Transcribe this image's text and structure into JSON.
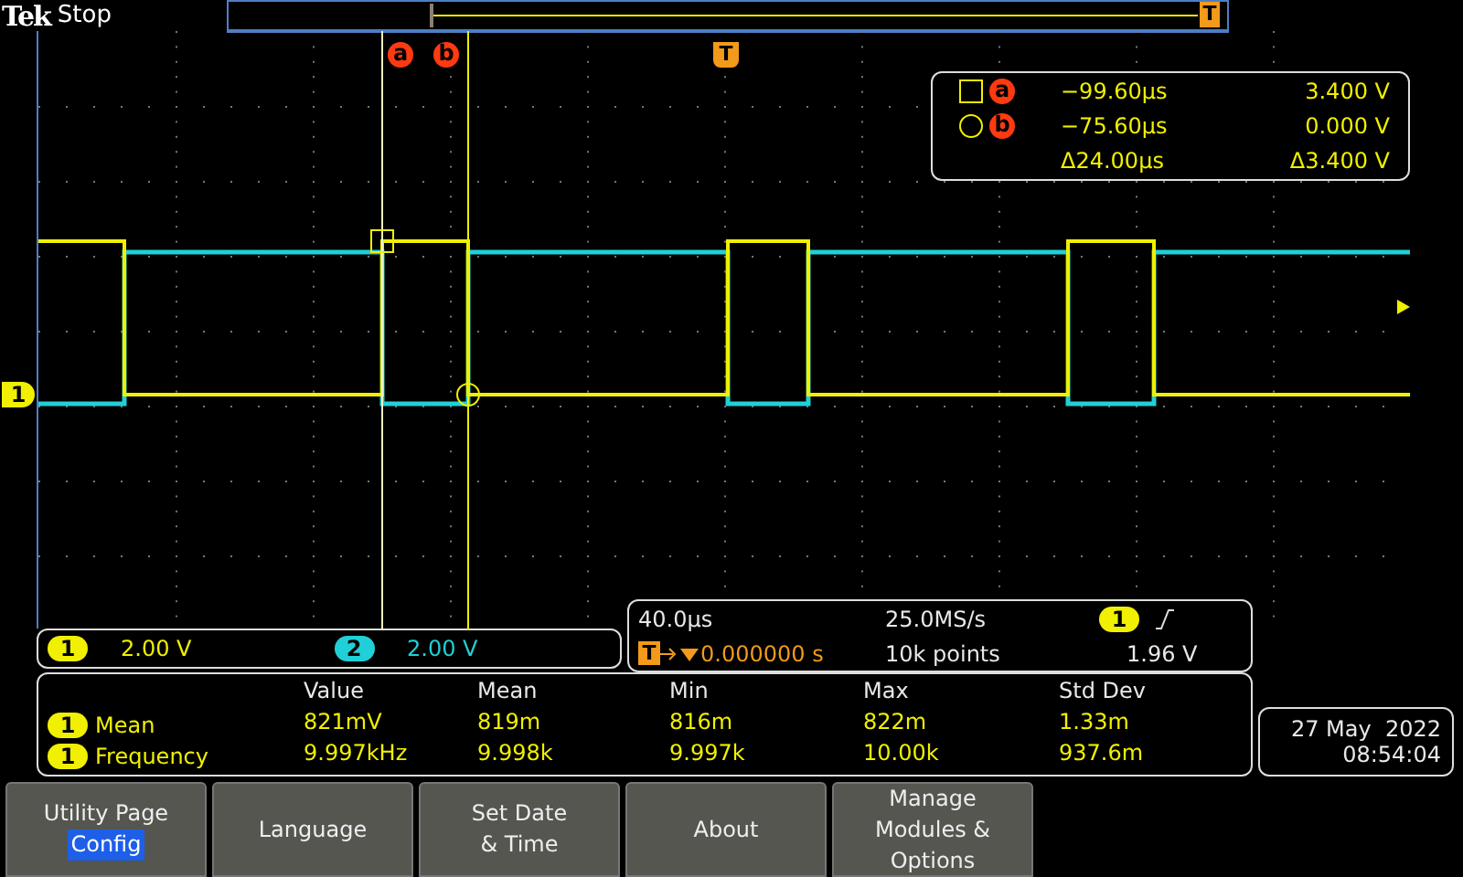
{
  "header": {
    "logo": "Tek",
    "state": "Stop",
    "trigger_label": "T"
  },
  "graticule": {
    "cursor_labels": [
      "a",
      "b"
    ],
    "trigger_label": "T",
    "ground_label": "1"
  },
  "cursor_readout": {
    "rows": [
      {
        "kind": "square",
        "marker": "a",
        "time": "−99.60µs",
        "voltage": "3.400 V"
      },
      {
        "kind": "circle",
        "marker": "b",
        "time": "−75.60µs",
        "voltage": "0.000 V"
      }
    ],
    "delta_time": "Δ24.00µs",
    "delta_voltage": "Δ3.400 V"
  },
  "channels": [
    {
      "number": "1",
      "scale": "2.00 V",
      "color": "#f0f000"
    },
    {
      "number": "2",
      "scale": "2.00 V",
      "color": "#20d0d8"
    }
  ],
  "acquisition": {
    "timebase": "40.0µs",
    "sample_rate": "25.0MS/s",
    "trigger_source": "1",
    "trigger_label": "T",
    "trigger_position": "0.000000 s",
    "record_length": "10k points",
    "trigger_level": "1.96 V"
  },
  "measurements": {
    "columns": [
      "Value",
      "Mean",
      "Min",
      "Max",
      "Std Dev"
    ],
    "rows": [
      {
        "source": "1",
        "name": "Mean",
        "values": [
          "821mV",
          "819m",
          "816m",
          "822m",
          "1.33m"
        ]
      },
      {
        "source": "1",
        "name": "Frequency",
        "values": [
          "9.997kHz",
          "9.998k",
          "9.997k",
          "10.00k",
          "937.6m"
        ]
      }
    ]
  },
  "datetime": {
    "date": "27 May  2022",
    "time": "08:54:04"
  },
  "buttons": [
    {
      "lines": [
        "Utility Page"
      ],
      "value": "Config"
    },
    {
      "lines": [
        "Language"
      ]
    },
    {
      "lines": [
        "Set Date",
        "& Time"
      ]
    },
    {
      "lines": [
        "About"
      ]
    },
    {
      "lines": [
        "Manage",
        "Modules &",
        "Options"
      ]
    }
  ]
}
